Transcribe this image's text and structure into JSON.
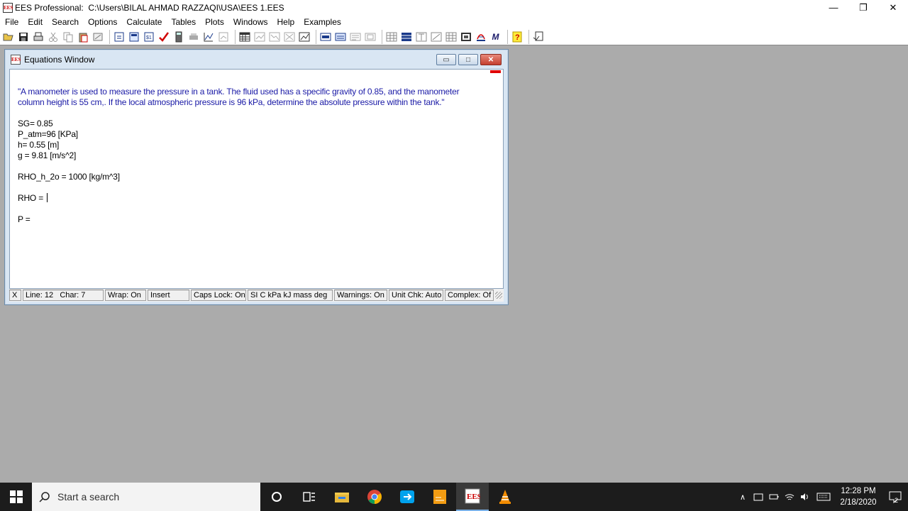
{
  "app": {
    "title": "EES Professional:  C:\\Users\\BILAL AHMAD RAZZAQI\\USA\\EES 1.EES",
    "icon_label": "EES",
    "controls": {
      "minimize": "—",
      "restore": "❐",
      "close": "✕"
    }
  },
  "menu": [
    "File",
    "Edit",
    "Search",
    "Options",
    "Calculate",
    "Tables",
    "Plots",
    "Windows",
    "Help",
    "Examples"
  ],
  "toolbar_icons": [
    "open-icon",
    "save-icon",
    "print-icon",
    "cut-icon",
    "copy-icon",
    "paste-icon",
    "check-icon",
    "info-icon",
    "variable-info-icon",
    "unit-icon",
    "check-units-icon",
    "calculator-icon",
    "solve-icon",
    "chart-icon",
    "table-icon",
    "plot-icon",
    "help-icon",
    "macro-icon"
  ],
  "equations_window": {
    "title": "Equations Window",
    "controls": {
      "minimize": "▭",
      "maximize": "□",
      "close": "✕"
    },
    "lines": [
      {
        "text": "\"A manometer is used to measure the pressure in a tank. The fluid used has a specific gravity of 0.85, and the manometer",
        "type": "comment"
      },
      {
        "text": "column height is 55 cm,. If the local atmospheric pressure is 96 kPa, determine the absolute pressure within the tank.\"",
        "type": "comment"
      },
      {
        "text": "",
        "type": "blank"
      },
      {
        "text": "SG= 0.85",
        "type": "code"
      },
      {
        "text": "P_atm=96 [KPa]",
        "type": "code"
      },
      {
        "text": "h= 0.55 [m]",
        "type": "code"
      },
      {
        "text": "g = 9.81 [m/s^2]",
        "type": "code"
      },
      {
        "text": "",
        "type": "blank"
      },
      {
        "text": "RHO_h_2o = 1000 [kg/m^3]",
        "type": "code"
      },
      {
        "text": "",
        "type": "blank"
      },
      {
        "text": "RHO = ",
        "type": "cursor"
      },
      {
        "text": "",
        "type": "blank"
      },
      {
        "text": "P = ",
        "type": "code"
      }
    ],
    "status": {
      "close": "X",
      "line": "Line: 12",
      "char": "Char: 7",
      "wrap": "Wrap: On",
      "mode": "Insert",
      "caps": "Caps Lock: On",
      "units": "SI C kPa kJ mass deg",
      "warnings": "Warnings: On",
      "unitchk": "Unit Chk: Auto",
      "complex": "Complex: Of"
    }
  },
  "taskbar": {
    "search_placeholder": "Start a search",
    "time": "12:28 PM",
    "date": "2/18/2020",
    "notification_count": "2"
  },
  "colors": {
    "comment": "#1a1aa6",
    "taskbar": "#1c1c1c",
    "desktop": "#ababab"
  }
}
